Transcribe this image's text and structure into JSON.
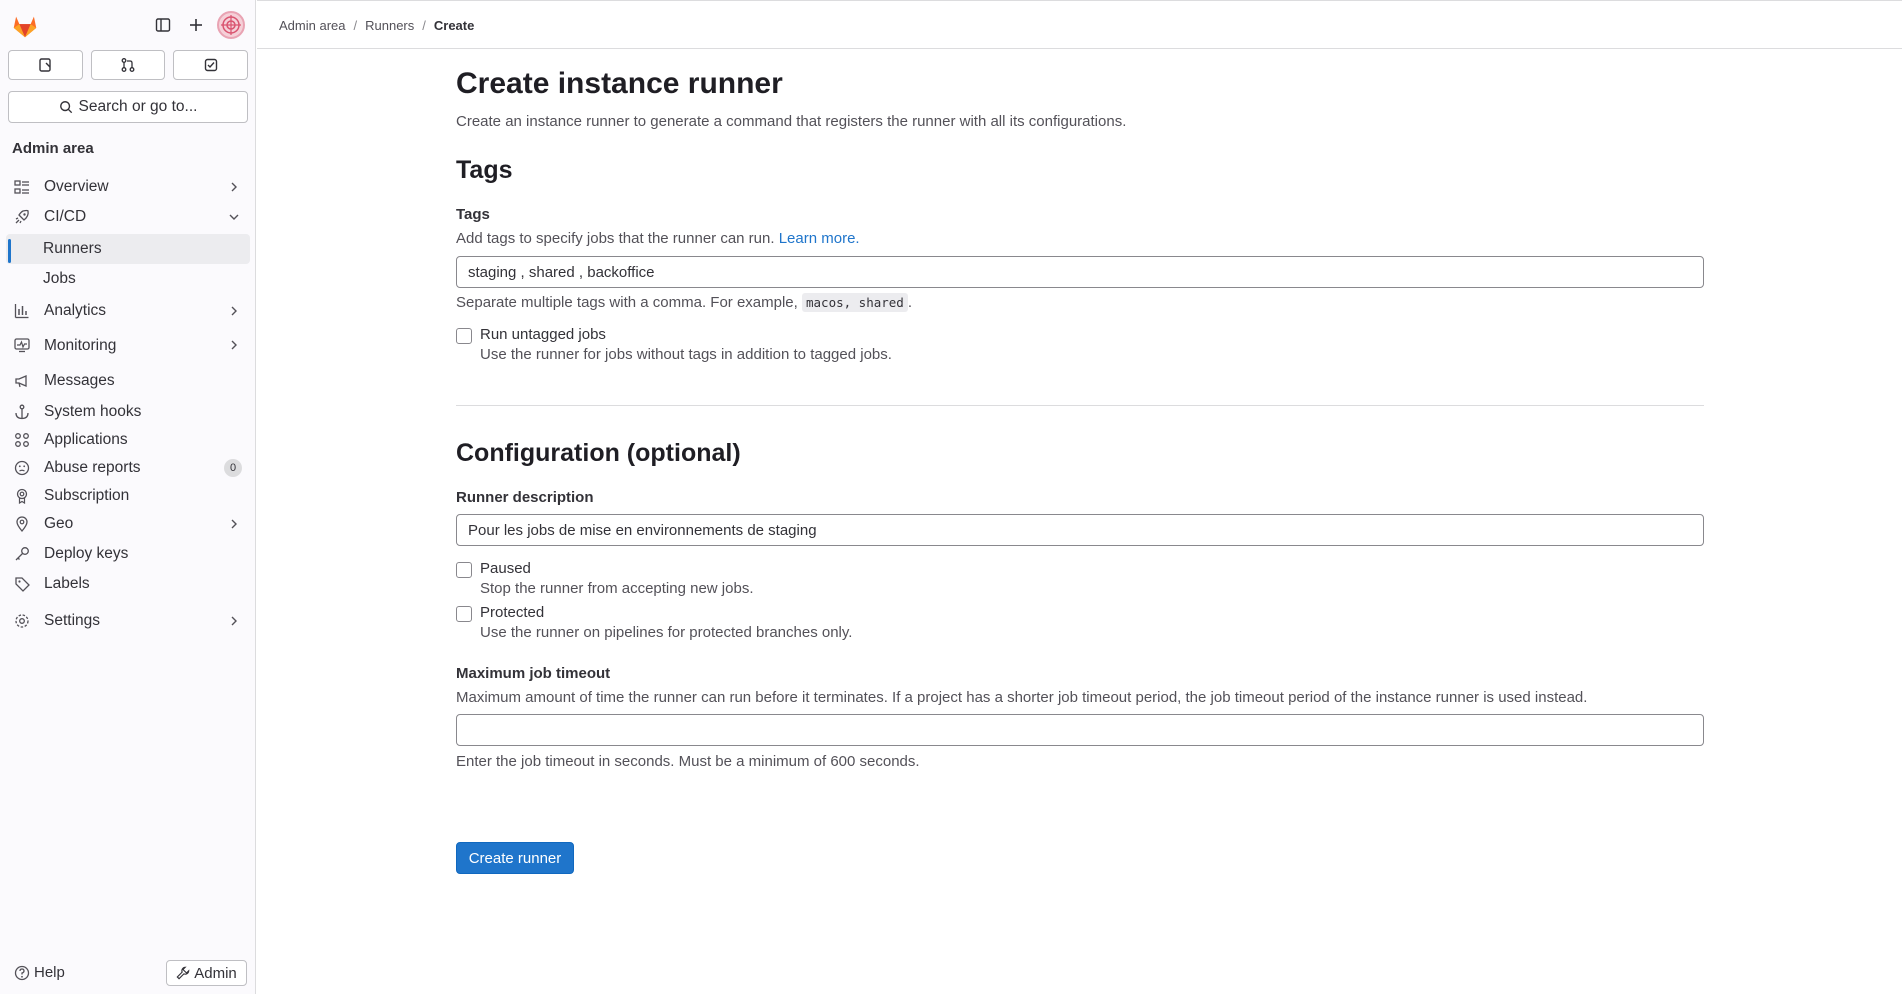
{
  "sidebar": {
    "search_label": "Search or go to...",
    "title": "Admin area",
    "items": [
      {
        "label": "Overview"
      },
      {
        "label": "CI/CD"
      },
      {
        "label": "Runners"
      },
      {
        "label": "Jobs"
      },
      {
        "label": "Analytics"
      },
      {
        "label": "Monitoring"
      },
      {
        "label": "Messages"
      },
      {
        "label": "System hooks"
      },
      {
        "label": "Applications"
      },
      {
        "label": "Abuse reports",
        "badge": "0"
      },
      {
        "label": "Subscription"
      },
      {
        "label": "Geo"
      },
      {
        "label": "Deploy keys"
      },
      {
        "label": "Labels"
      },
      {
        "label": "Settings"
      }
    ],
    "help_label": "Help",
    "admin_label": "Admin"
  },
  "breadcrumb": [
    "Admin area",
    "Runners",
    "Create"
  ],
  "page": {
    "title": "Create instance runner",
    "description": "Create an instance runner to generate a command that registers the runner with all its configurations."
  },
  "tags_section": {
    "title": "Tags",
    "label": "Tags",
    "help_prefix": "Add tags to specify jobs that the runner can run.",
    "help_link": "Learn more.",
    "value": "staging , shared , backoffice",
    "hint_prefix": "Separate multiple tags with a comma. For example,",
    "hint_code": "macos, shared",
    "hint_suffix": ".",
    "untagged_label": "Run untagged jobs",
    "untagged_help": "Use the runner for jobs without tags in addition to tagged jobs."
  },
  "config_section": {
    "title": "Configuration (optional)",
    "description_label": "Runner description",
    "description_value": "Pour les jobs de mise en environnements de staging",
    "paused_label": "Paused",
    "paused_help": "Stop the runner from accepting new jobs.",
    "protected_label": "Protected",
    "protected_help": "Use the runner on pipelines for protected branches only.",
    "timeout_label": "Maximum job timeout",
    "timeout_help": "Maximum amount of time the runner can run before it terminates. If a project has a shorter job timeout period, the job timeout period of the instance runner is used instead.",
    "timeout_value": "",
    "timeout_hint": "Enter the job timeout in seconds. Must be a minimum of 600 seconds."
  },
  "submit_label": "Create runner",
  "colors": {
    "accent": "#1f75cb",
    "text": "#333238"
  }
}
